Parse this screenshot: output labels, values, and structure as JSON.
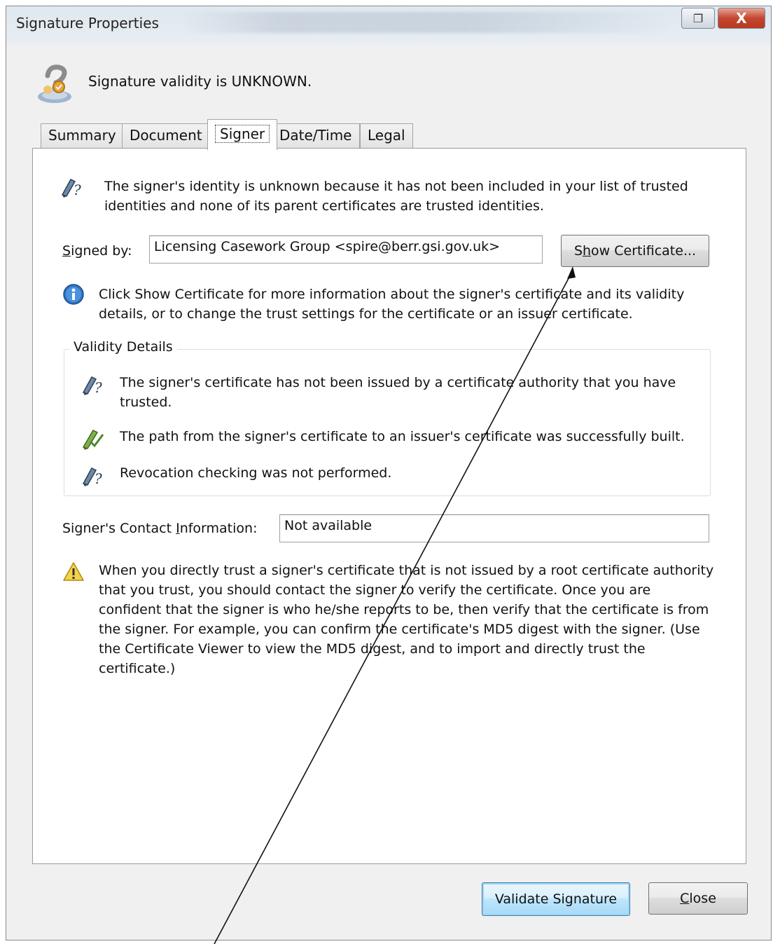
{
  "window": {
    "title": "Signature Properties",
    "close_glyph": "X",
    "restore_glyph": "❐"
  },
  "header": {
    "icon": "unknown-signature-icon",
    "status": "Signature validity is UNKNOWN."
  },
  "tabs": [
    {
      "label": "Summary",
      "active": false
    },
    {
      "label": "Document",
      "active": false
    },
    {
      "label": "Signer",
      "active": true
    },
    {
      "label": "Date/Time",
      "active": false
    },
    {
      "label": "Legal",
      "active": false
    }
  ],
  "signer": {
    "identity_message": "The signer's identity is unknown because it has not been included in your list of trusted identities and none of its parent certificates are trusted identities.",
    "signed_by_label_pre": "",
    "signed_by_label_ul": "S",
    "signed_by_label_post": "igned by:",
    "signed_by_value": "Licensing Casework Group <spire@berr.gsi.gov.uk>",
    "show_certificate_pre": "S",
    "show_certificate_ul": "h",
    "show_certificate_post": "ow Certificate...",
    "info_message": "Click Show Certificate for more information about the signer's certificate and its validity details, or to change the trust settings for the certificate or an issuer certificate."
  },
  "validity": {
    "label": "Validity Details",
    "items": [
      {
        "icon": "unknown-pen-icon",
        "text": "The signer's certificate has not been issued by a certificate authority that you have trusted."
      },
      {
        "icon": "valid-pen-icon",
        "text": "The path from the signer's certificate to an issuer's certificate was successfully built."
      },
      {
        "icon": "unknown-pen-icon",
        "text": "Revocation checking was not performed."
      }
    ]
  },
  "contact": {
    "label_pre": "Signer's Contact ",
    "label_ul": "I",
    "label_post": "nformation:",
    "value": "Not available"
  },
  "warning": {
    "text": "When you directly trust a signer's certificate that is not issued by a root certificate authority that you trust, you should contact the signer to verify the certificate. Once you are confident that the signer is who he/she reports to be, then verify that the certificate is from the signer. For example, you can confirm the certificate's MD5 digest with the signer. (Use the Certificate Viewer to view the MD5 digest, and to import and directly trust the certificate.)"
  },
  "footer": {
    "validate_label": "Validate Signature",
    "close_pre": "",
    "close_ul": "C",
    "close_post": "lose"
  },
  "colors": {
    "accent": "#3c7fb1",
    "close_button": "#c4462f"
  }
}
